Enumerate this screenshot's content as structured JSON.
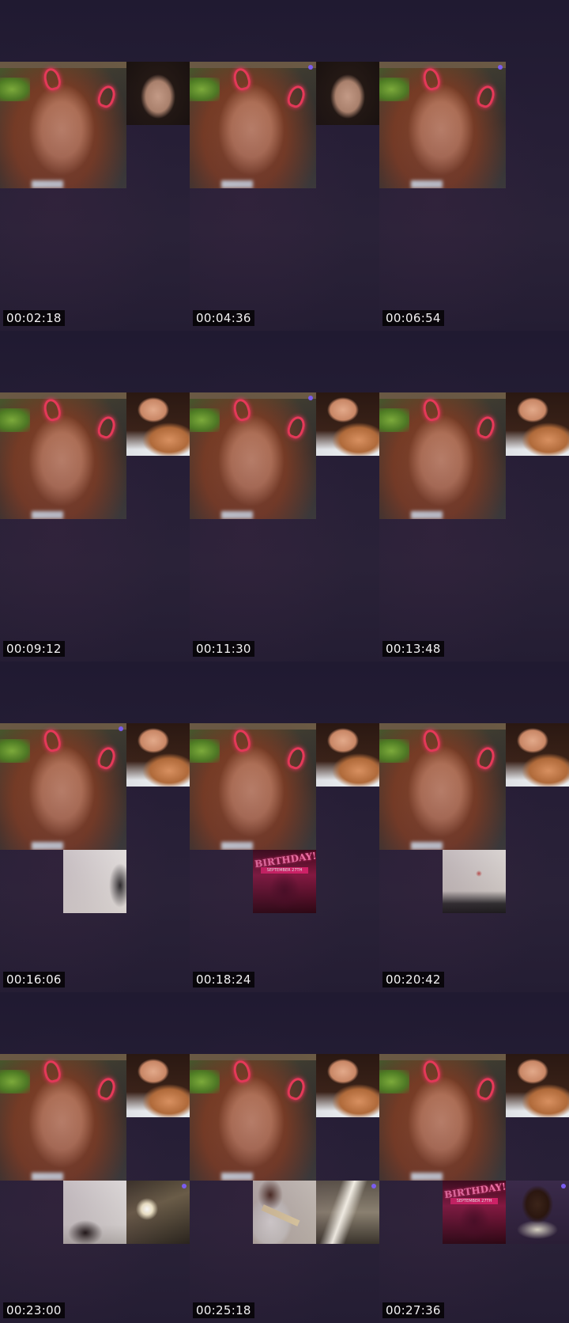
{
  "contact_sheet": {
    "timestamps": [
      "00:02:18",
      "00:04:36",
      "00:06:54",
      "00:09:12",
      "00:11:30",
      "00:13:48",
      "00:16:06",
      "00:18:24",
      "00:20:42",
      "00:23:00",
      "00:25:18",
      "00:27:36"
    ]
  },
  "thumbnails": {
    "birthday_flyer": {
      "title": "BIRTHDAY!",
      "subtitle": "SEPTEMBER 27TH"
    }
  },
  "colors": {
    "background": "#1f1a2e",
    "timestamp_bg": "#000000",
    "timestamp_text": "#ffffff",
    "indicator_dot": "#7a5cf0",
    "horn_glow": "#f03a5a"
  },
  "icons": {
    "participant_indicator": "dot-icon"
  }
}
